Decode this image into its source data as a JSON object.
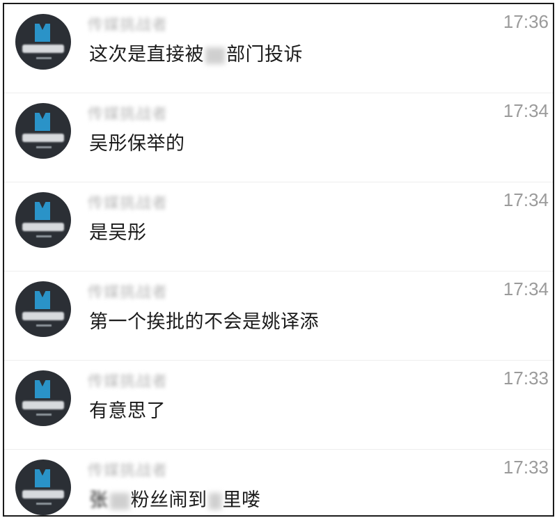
{
  "messages": [
    {
      "sender": "传媒挑战者",
      "time": "17:36",
      "text_before": "这次是直接被",
      "text_after": "部门投诉"
    },
    {
      "sender": "传媒挑战者",
      "time": "17:34",
      "text": "吴彤保举的"
    },
    {
      "sender": "传媒挑战者",
      "time": "17:34",
      "text": "是吴彤"
    },
    {
      "sender": "传媒挑战者",
      "time": "17:34",
      "text": "第一个挨批的不会是姚译添"
    },
    {
      "sender": "传媒挑战者",
      "time": "17:33",
      "text": "有意思了"
    },
    {
      "sender": "传媒挑战者",
      "time": "17:33",
      "text_before": "张",
      "text_after": "粉丝闹到",
      "text_end": "里喽"
    }
  ]
}
